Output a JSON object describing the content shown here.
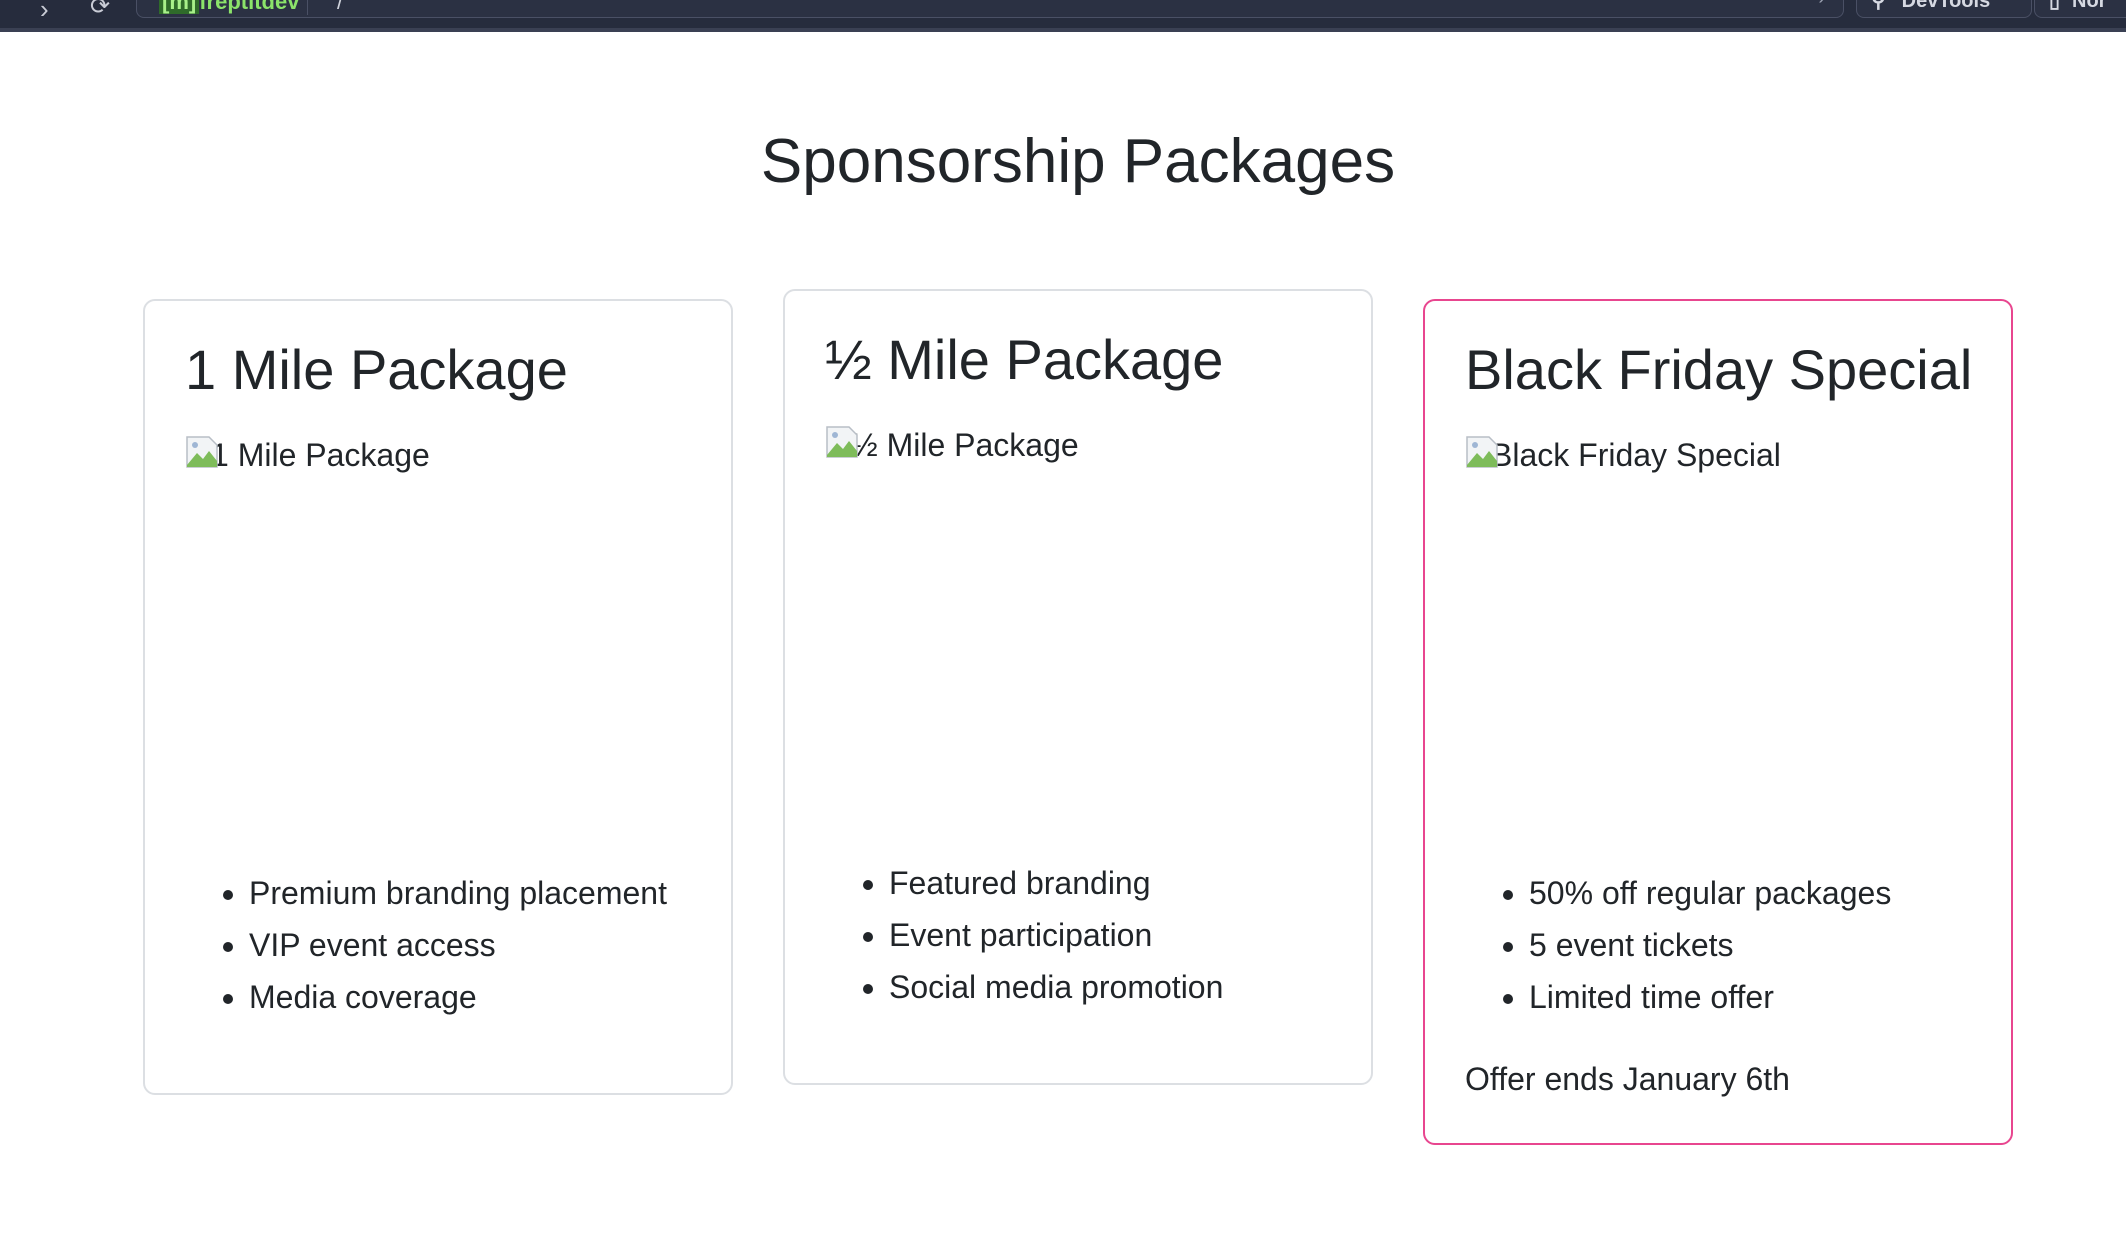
{
  "browser": {
    "address_tag": "[m]",
    "address_text": "freptitdev",
    "address_suffix": "/",
    "pills": [
      "DevTools",
      "Nor"
    ]
  },
  "page": {
    "title": "Sponsorship Packages"
  },
  "packages": [
    {
      "title": "1 Mile Package",
      "image_alt": "1 Mile Package",
      "features": [
        "Premium branding placement",
        "VIP event access",
        "Media coverage"
      ]
    },
    {
      "title": "½ Mile Package",
      "image_alt": "½ Mile Package",
      "features": [
        "Featured branding",
        "Event participation",
        "Social media promotion"
      ]
    },
    {
      "title": "Black Friday Special",
      "image_alt": "Black Friday Special",
      "features": [
        "50% off regular packages",
        "5 event tickets",
        "Limited time offer"
      ],
      "note": "Offer ends January 6th",
      "highlight_color": "#e8468f"
    }
  ]
}
